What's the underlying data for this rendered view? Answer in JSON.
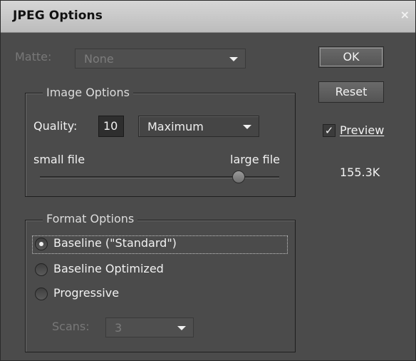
{
  "window": {
    "title": "JPEG Options",
    "close_glyph": "×"
  },
  "matte": {
    "label": "Matte:",
    "value": "None"
  },
  "buttons": {
    "ok": "OK",
    "reset": "Reset"
  },
  "preview": {
    "label": "Preview",
    "checked": true,
    "check_glyph": "✓"
  },
  "file_size": "155.3K",
  "image_options": {
    "legend": "Image Options",
    "quality_label": "Quality:",
    "quality_value": "10",
    "quality_preset": "Maximum",
    "small_label": "small file",
    "large_label": "large file",
    "slider_level": 0.83
  },
  "format_options": {
    "legend": "Format Options",
    "options": [
      {
        "label": "Baseline (\"Standard\")",
        "selected": true
      },
      {
        "label": "Baseline Optimized",
        "selected": false
      },
      {
        "label": "Progressive",
        "selected": false
      }
    ],
    "scans_label": "Scans:",
    "scans_value": "3"
  },
  "icons": {
    "close": "close-icon",
    "dropdown": "chevron-down-icon",
    "check": "checkmark-icon"
  }
}
